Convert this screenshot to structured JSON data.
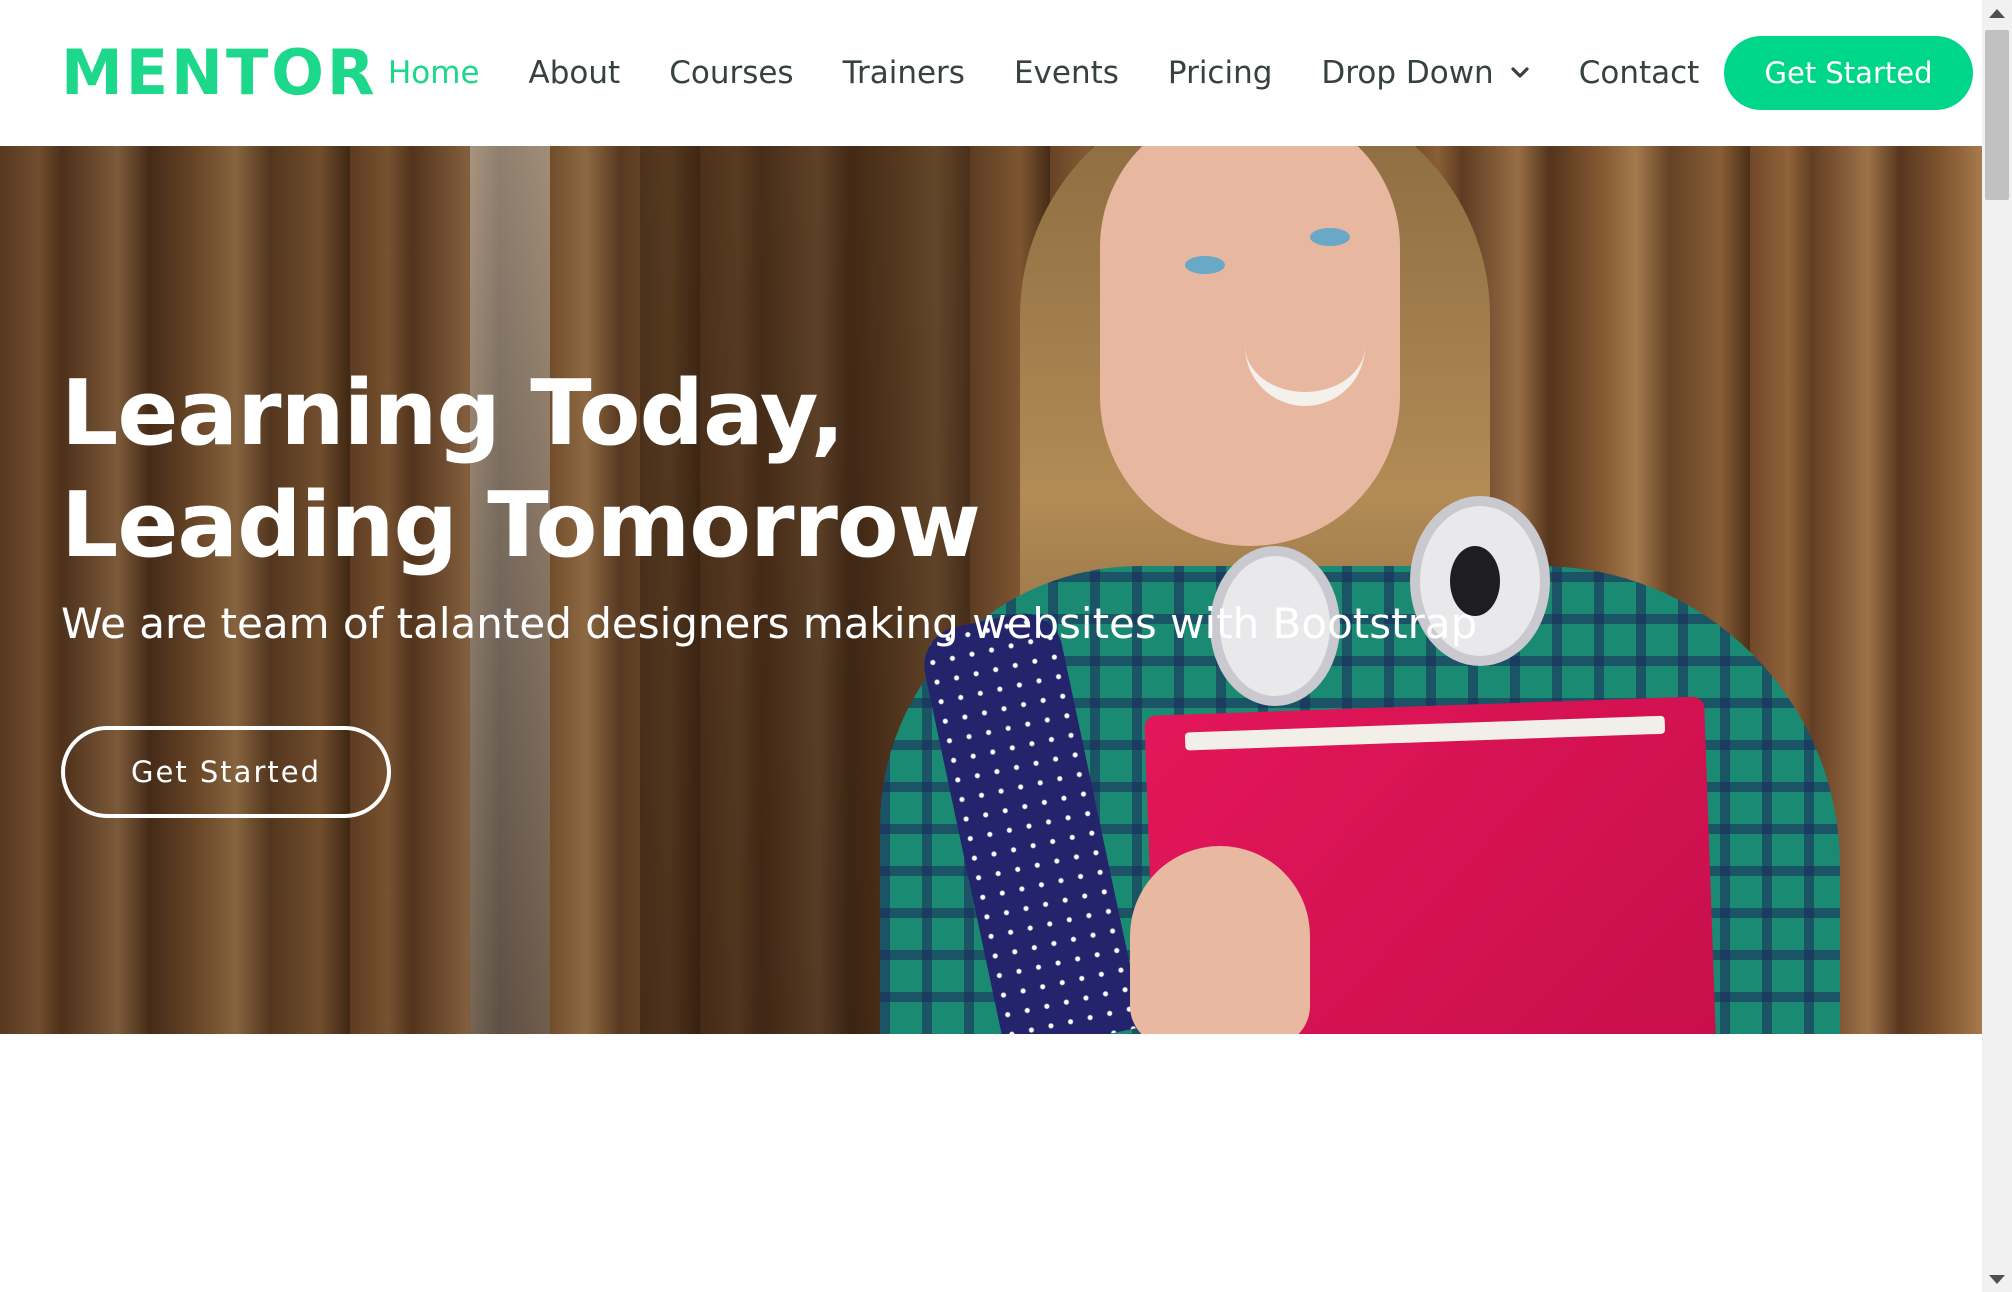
{
  "header": {
    "logo": "MENTOR",
    "nav": [
      {
        "label": "Home",
        "active": true
      },
      {
        "label": "About"
      },
      {
        "label": "Courses"
      },
      {
        "label": "Trainers"
      },
      {
        "label": "Events"
      },
      {
        "label": "Pricing"
      },
      {
        "label": "Drop Down",
        "has_dropdown": true
      },
      {
        "label": "Contact"
      }
    ],
    "cta_label": "Get Started"
  },
  "hero": {
    "title_line1": "Learning Today,",
    "title_line2": "Leading Tomorrow",
    "subtitle": "We are team of talanted designers making websites with Bootstrap",
    "button_label": "Get Started",
    "background_image": "student-with-red-folder-and-headphones"
  },
  "colors": {
    "accent": "#1dd78a",
    "nav_text": "#37423b",
    "hero_text": "#ffffff"
  },
  "icons": {
    "dropdown": "chevron-down-icon",
    "scroll_up": "scroll-up-arrow-icon",
    "scroll_down": "scroll-down-arrow-icon"
  }
}
